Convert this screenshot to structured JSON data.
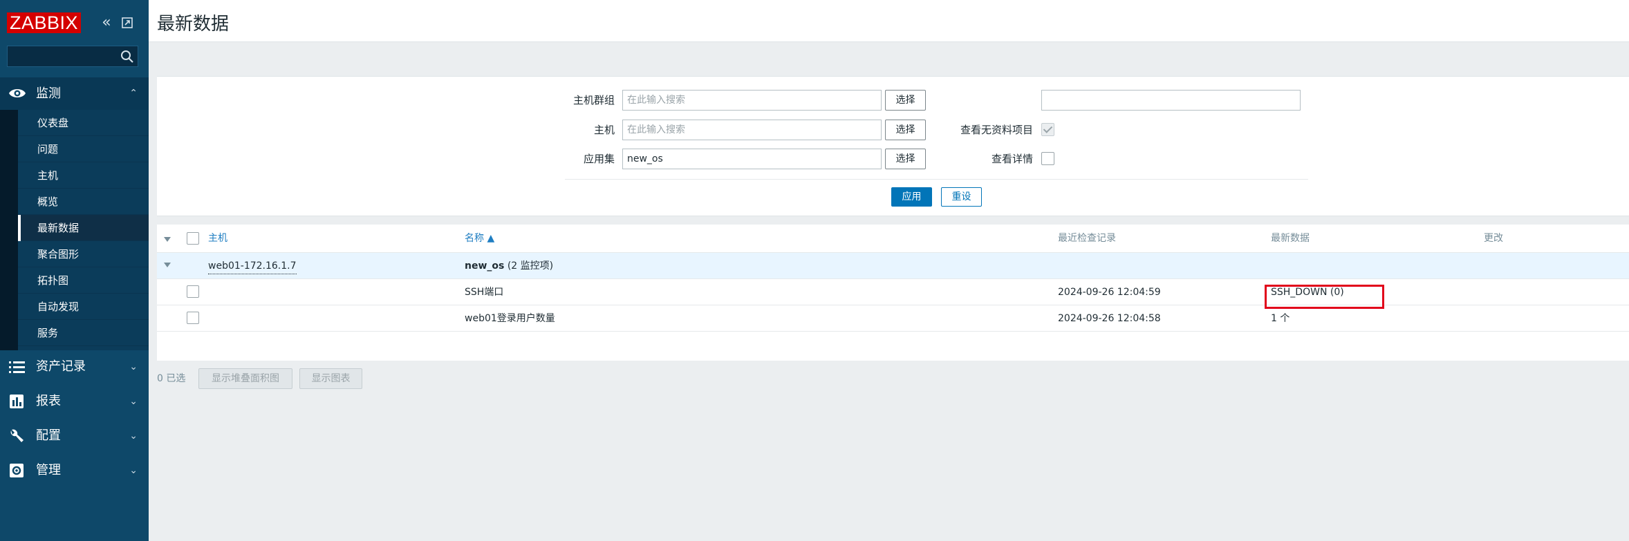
{
  "sidebar": {
    "logo": "ZABBIX",
    "search_placeholder": "",
    "monitoring": {
      "label": "监测",
      "items": [
        "仪表盘",
        "问题",
        "主机",
        "概览",
        "最新数据",
        "聚合图形",
        "拓扑图",
        "自动发现",
        "服务"
      ],
      "active": "最新数据"
    },
    "groups": [
      "资产记录",
      "报表",
      "配置",
      "管理"
    ]
  },
  "header": {
    "title": "最新数据"
  },
  "filter": {
    "host_group_label": "主机群组",
    "host_group_placeholder": "在此输入搜索",
    "host_label": "主机",
    "host_placeholder": "在此输入搜索",
    "application_label": "应用集",
    "application_value": "new_os",
    "select_label": "选择",
    "name_label": "名称",
    "name_value": "",
    "show_no_data_label": "查看无资料项目",
    "show_no_data_checked": true,
    "show_details_label": "查看详情",
    "show_details_checked": false,
    "apply_label": "应用",
    "reset_label": "重设"
  },
  "table": {
    "columns": {
      "host": "主机",
      "name": "名称 ▲",
      "last_check": "最近检查记录",
      "last_value": "最新数据",
      "change": "更改"
    },
    "group": {
      "host": "web01-172.16.1.7",
      "application": "new_os",
      "count": "(2 监控项)"
    },
    "rows": [
      {
        "name": "SSH端口",
        "last_check": "2024-09-26 12:04:59",
        "last_value": "SSH_DOWN (0)"
      },
      {
        "name": "web01登录用户数量",
        "last_check": "2024-09-26 12:04:58",
        "last_value": "1 个"
      }
    ]
  },
  "footer": {
    "selected": "0 已选",
    "stacked_graph": "显示堆叠面积图",
    "graph": "显示图表"
  },
  "colors": {
    "sidebar": "#0e4869",
    "accent": "#0275b8",
    "logo": "#d40000",
    "highlight": "#e1001a"
  }
}
